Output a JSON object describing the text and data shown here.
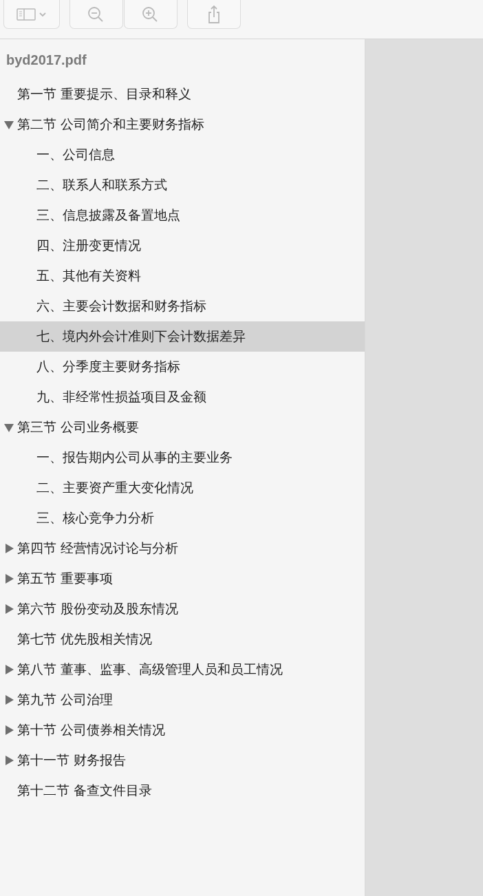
{
  "toolbar": {
    "buttons": [
      {
        "kind": "sidebar",
        "disabled": true
      },
      {
        "kind": "zoom-out",
        "disabled": true
      },
      {
        "kind": "zoom-in",
        "disabled": true
      },
      {
        "kind": "share",
        "disabled": true
      }
    ]
  },
  "sidebar": {
    "title": "byd2017.pdf",
    "items": [
      {
        "label": "第一节 重要提示、目录和释义",
        "kind": "leaf",
        "selected": false
      },
      {
        "label": "第二节 公司简介和主要财务指标",
        "kind": "group",
        "expanded": true,
        "selected": false,
        "children": [
          {
            "label": "一、公司信息",
            "selected": false
          },
          {
            "label": "二、联系人和联系方式",
            "selected": false
          },
          {
            "label": "三、信息披露及备置地点",
            "selected": false
          },
          {
            "label": "四、注册变更情况",
            "selected": false
          },
          {
            "label": "五、其他有关资料",
            "selected": false
          },
          {
            "label": "六、主要会计数据和财务指标",
            "selected": false
          },
          {
            "label": "七、境内外会计准则下会计数据差异",
            "selected": true
          },
          {
            "label": "八、分季度主要财务指标",
            "selected": false
          },
          {
            "label": "九、非经常性损益项目及金额",
            "selected": false
          }
        ]
      },
      {
        "label": "第三节 公司业务概要",
        "kind": "group",
        "expanded": true,
        "selected": false,
        "children": [
          {
            "label": "一、报告期内公司从事的主要业务",
            "selected": false
          },
          {
            "label": "二、主要资产重大变化情况",
            "selected": false
          },
          {
            "label": "三、核心竞争力分析",
            "selected": false
          }
        ]
      },
      {
        "label": "第四节 经营情况讨论与分析",
        "kind": "group",
        "expanded": false,
        "selected": false
      },
      {
        "label": "第五节 重要事项",
        "kind": "group",
        "expanded": false,
        "selected": false
      },
      {
        "label": "第六节 股份变动及股东情况",
        "kind": "group",
        "expanded": false,
        "selected": false
      },
      {
        "label": "第七节 优先股相关情况",
        "kind": "leaf",
        "selected": false
      },
      {
        "label": "第八节 董事、监事、高级管理人员和员工情况",
        "kind": "group",
        "expanded": false,
        "selected": false
      },
      {
        "label": "第九节 公司治理",
        "kind": "group",
        "expanded": false,
        "selected": false
      },
      {
        "label": "第十节 公司债券相关情况",
        "kind": "group",
        "expanded": false,
        "selected": false
      },
      {
        "label": "第十一节 财务报告",
        "kind": "group",
        "expanded": false,
        "selected": false
      },
      {
        "label": "第十二节 备查文件目录",
        "kind": "leaf",
        "selected": false
      }
    ]
  }
}
